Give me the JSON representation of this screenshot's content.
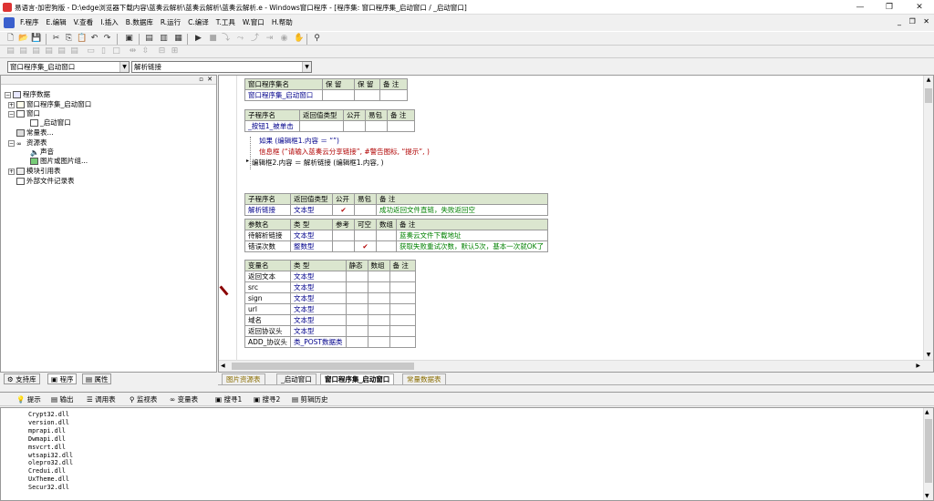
{
  "window": {
    "title": "易语言-加密狗版 - D:\\edge浏览器下载内容\\蓝奏云解析\\蓝奏云解析\\蓝奏云解析.e - Windows窗口程序 - [程序集: 窗口程序集_启动窗口 / _启动窗口]",
    "controls": [
      "—",
      "❐",
      "✕"
    ]
  },
  "menu": {
    "items": [
      "F.程序",
      "E.编辑",
      "V.查看",
      "I.插入",
      "B.数据库",
      "R.运行",
      "C.编译",
      "T.工具",
      "W.窗口",
      "H.帮助"
    ],
    "mdi_controls": "_ ❐ ✕"
  },
  "combos": {
    "assembly": "窗口程序集_启动窗口",
    "subroutine": "解析链接"
  },
  "left_panel": {
    "tree": {
      "root": "程序数据",
      "assembly": "窗口程序集_启动窗口",
      "window_group": "窗口",
      "window_item": "_启动窗口",
      "constants": "常量表...",
      "resources": "资源表",
      "sound": "声音",
      "images": "图片或图片组...",
      "module_refs": "模块引用表",
      "external_files": "外部文件记录表"
    },
    "tabs": [
      "支持库",
      "程序",
      "属性"
    ]
  },
  "editor": {
    "assembly_table": {
      "headers": [
        "窗口程序集名",
        "保 留",
        "保 留",
        "备 注"
      ],
      "row": [
        "窗口程序集_启动窗口",
        "",
        "",
        ""
      ]
    },
    "sub1_table": {
      "headers": [
        "子程序名",
        "返回值类型",
        "公开",
        "易包",
        "备 注"
      ],
      "row": [
        "_按钮1_被单击",
        "",
        "",
        "",
        ""
      ]
    },
    "code_lines": [
      "如果 (编辑框1.内容 ＝ “”)",
      "信息框 (“请输入蓝奏云分享链接”, #警告图标, “提示”, )",
      "编辑框2.内容 ＝ 解析链接 (编辑框1.内容, )"
    ],
    "sub2_table": {
      "headers": [
        "子程序名",
        "返回值类型",
        "公开",
        "易包",
        "备 注"
      ],
      "row": [
        "解析链接",
        "文本型",
        "✔",
        "",
        "成功返回文件直链，失败返回空"
      ]
    },
    "param_table": {
      "headers": [
        "参数名",
        "类 型",
        "参考",
        "可空",
        "数组",
        "备 注"
      ],
      "rows": [
        [
          "待解析链接",
          "文本型",
          "",
          "",
          "",
          "蓝奏云文件下载地址"
        ],
        [
          "错误次数",
          "整数型",
          "",
          "✔",
          "",
          "获取失败重试次数，默认5次，基本一次就OK了"
        ]
      ]
    },
    "var_table": {
      "headers": [
        "变量名",
        "类 型",
        "静态",
        "数组",
        "备 注"
      ],
      "rows": [
        [
          "返回文本",
          "文本型"
        ],
        [
          "src",
          "文本型"
        ],
        [
          "sign",
          "文本型"
        ],
        [
          "url",
          "文本型"
        ],
        [
          "域名",
          "文本型"
        ],
        [
          "返回协议头",
          "文本型"
        ],
        [
          "ADD_协议头",
          "类_POST数据类"
        ]
      ]
    },
    "tabs": [
      "图片资源表",
      "_启动窗口",
      "窗口程序集_启动窗口",
      "常量数据表"
    ]
  },
  "bottom_panel": {
    "tabs": [
      "提示",
      "输出",
      "调用表",
      "监视表",
      "变量表",
      "搜寻1",
      "搜寻2",
      "剪辑历史"
    ],
    "output_lines": [
      "Crypt32.dll",
      "version.dll",
      "mprapi.dll",
      "Dwmapi.dll",
      "msvcrt.dll",
      "wtsapi32.dll",
      "olepro32.dll",
      "Credui.dll",
      "UxTheme.dll",
      "Secur32.dll"
    ]
  }
}
